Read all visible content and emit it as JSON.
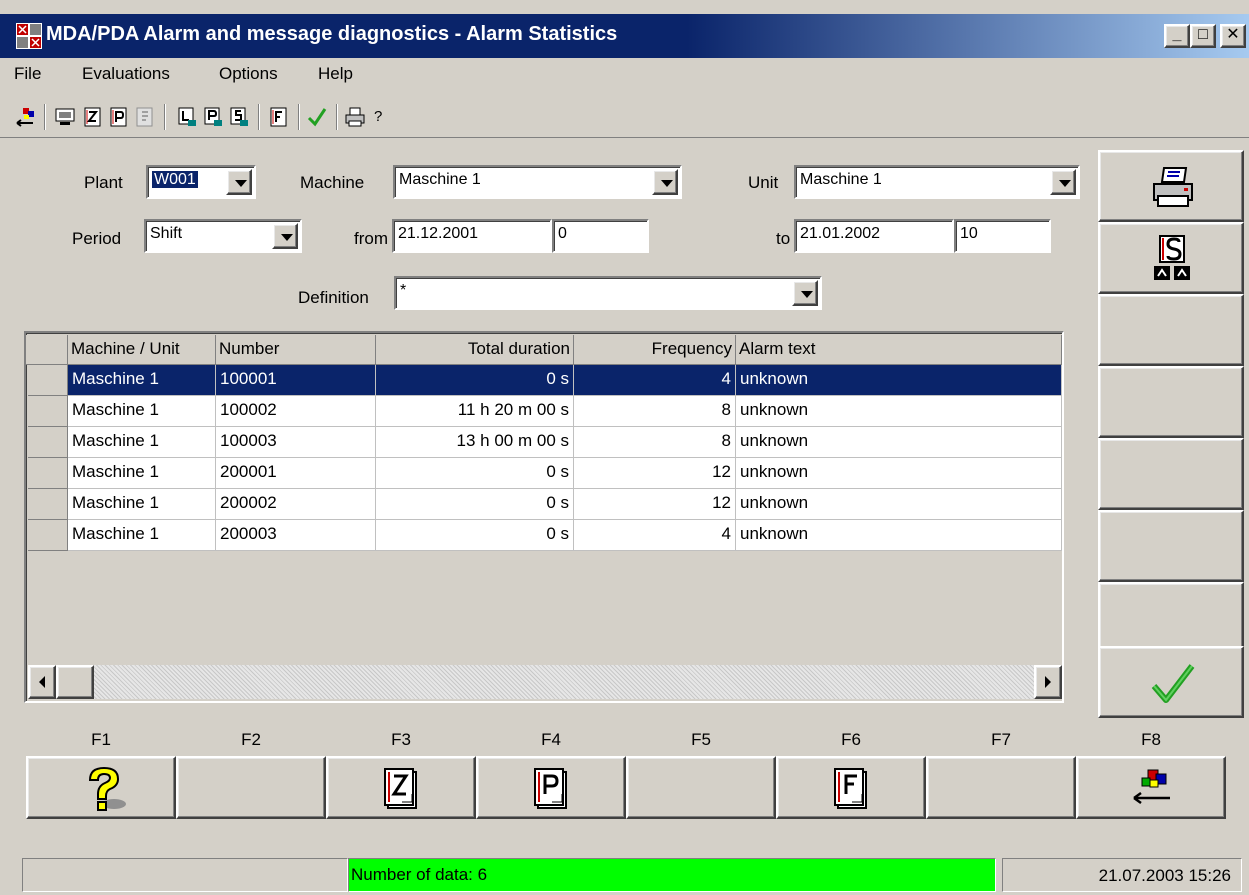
{
  "window": {
    "title": "MDA/PDA Alarm and message diagnostics - Alarm Statistics",
    "min": "_",
    "max": "□",
    "close": "✕"
  },
  "menu": [
    "File",
    "Evaluations",
    "Options",
    "Help"
  ],
  "toolbar": {
    "help": "?"
  },
  "form": {
    "plant_label": "Plant",
    "plant_value": "W001",
    "machine_label": "Machine",
    "machine_value": "Maschine 1",
    "unit_label": "Unit",
    "unit_value": "Maschine 1",
    "period_label": "Period",
    "period_value": "Shift",
    "from_label": "from",
    "from_date": "21.12.2001",
    "from_shift": "0",
    "to_label": "to",
    "to_date": "21.01.2002",
    "to_shift": "10",
    "definition_label": "Definition",
    "definition_value": "*"
  },
  "table": {
    "headers": [
      "Machine / Unit",
      "Number",
      "Total duration",
      "Frequency",
      "Alarm text"
    ],
    "rows": [
      [
        "Maschine 1",
        "100001",
        "0 s",
        "4",
        "unknown"
      ],
      [
        "Maschine 1",
        "100002",
        "11 h 20 m 00 s",
        "8",
        "unknown"
      ],
      [
        "Maschine 1",
        "100003",
        "13 h 00 m 00 s",
        "8",
        "unknown"
      ],
      [
        "Maschine 1",
        "200001",
        "0 s",
        "12",
        "unknown"
      ],
      [
        "Maschine 1",
        "200002",
        "0 s",
        "12",
        "unknown"
      ],
      [
        "Maschine 1",
        "200003",
        "0 s",
        "4",
        "unknown"
      ]
    ]
  },
  "fkeys": [
    "F1",
    "F2",
    "F3",
    "F4",
    "F5",
    "F6",
    "F7",
    "F8"
  ],
  "fbuttons": {
    "f3": "Z",
    "f4": "P",
    "f6": "F"
  },
  "right_panel": {
    "print_icon": "printer-icon",
    "stats_icon": "statistics-icon",
    "ok_icon": "checkmark-icon"
  },
  "status": {
    "left": "",
    "message": "Number of data:  6",
    "datetime": "21.07.2003 15:26"
  },
  "colors": {
    "titlebar": "#0a246a",
    "selection": "#0a246a",
    "status_ok": "#00ff00",
    "check": "#22a022"
  }
}
